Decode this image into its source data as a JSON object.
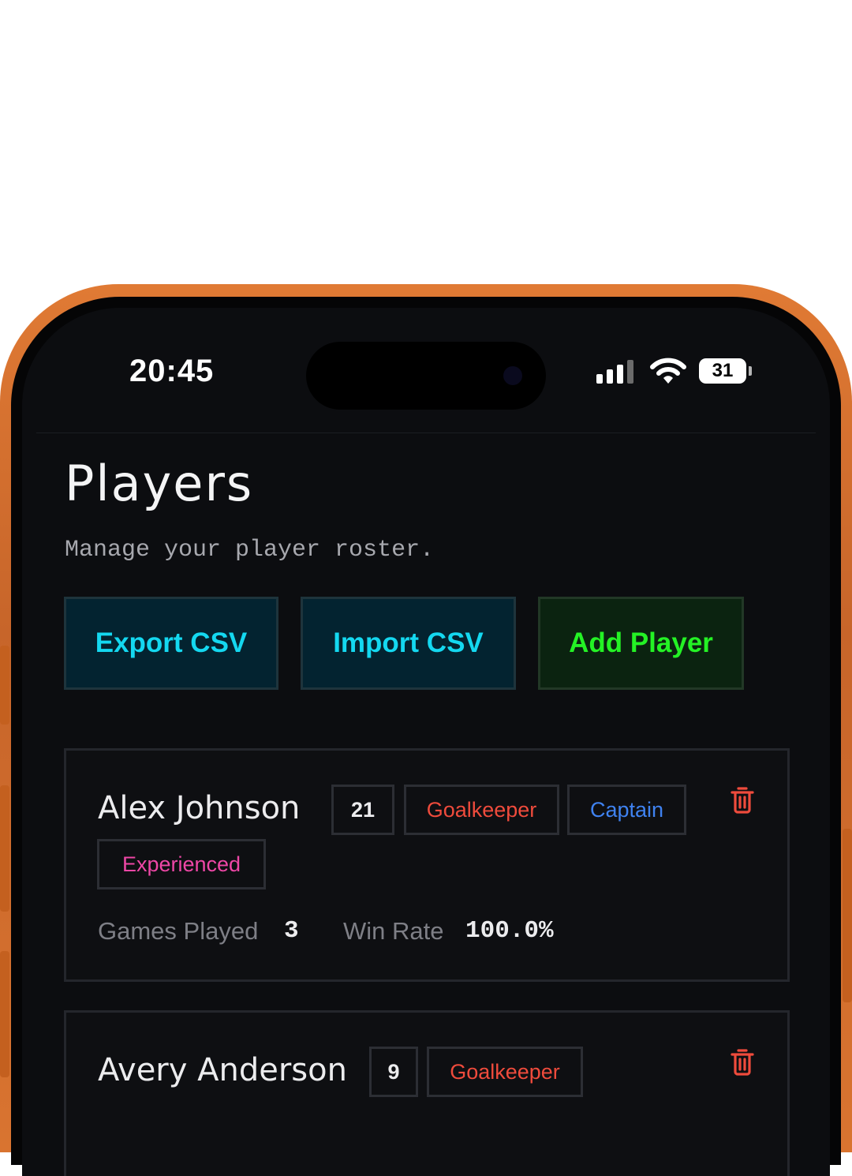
{
  "status_bar": {
    "time": "20:45",
    "battery_level": "31",
    "signal_bars": 3
  },
  "page": {
    "title": "Players",
    "subtitle": "Manage your player roster."
  },
  "actions": {
    "export_label": "Export CSV",
    "import_label": "Import CSV",
    "add_label": "Add Player"
  },
  "players": [
    {
      "name": "Alex Johnson",
      "number": "21",
      "tags": [
        "Goalkeeper",
        "Captain",
        "Experienced"
      ],
      "stats": {
        "games_label": "Games Played",
        "games_value": "3",
        "winrate_label": "Win Rate",
        "winrate_value": "100.0%"
      }
    },
    {
      "name": "Avery Anderson",
      "number": "9",
      "tags": [
        "Goalkeeper"
      ]
    }
  ],
  "icons": {
    "delete": "trash-icon"
  },
  "colors": {
    "background": "#0c0d10",
    "accent_cyan": "#14d8f0",
    "accent_green": "#24f225",
    "goalkeeper": "#ef4b3c",
    "captain": "#3f82f0",
    "experienced": "#ee47a6",
    "delete": "#ef4b3c",
    "phone_frame": "#d97430"
  }
}
